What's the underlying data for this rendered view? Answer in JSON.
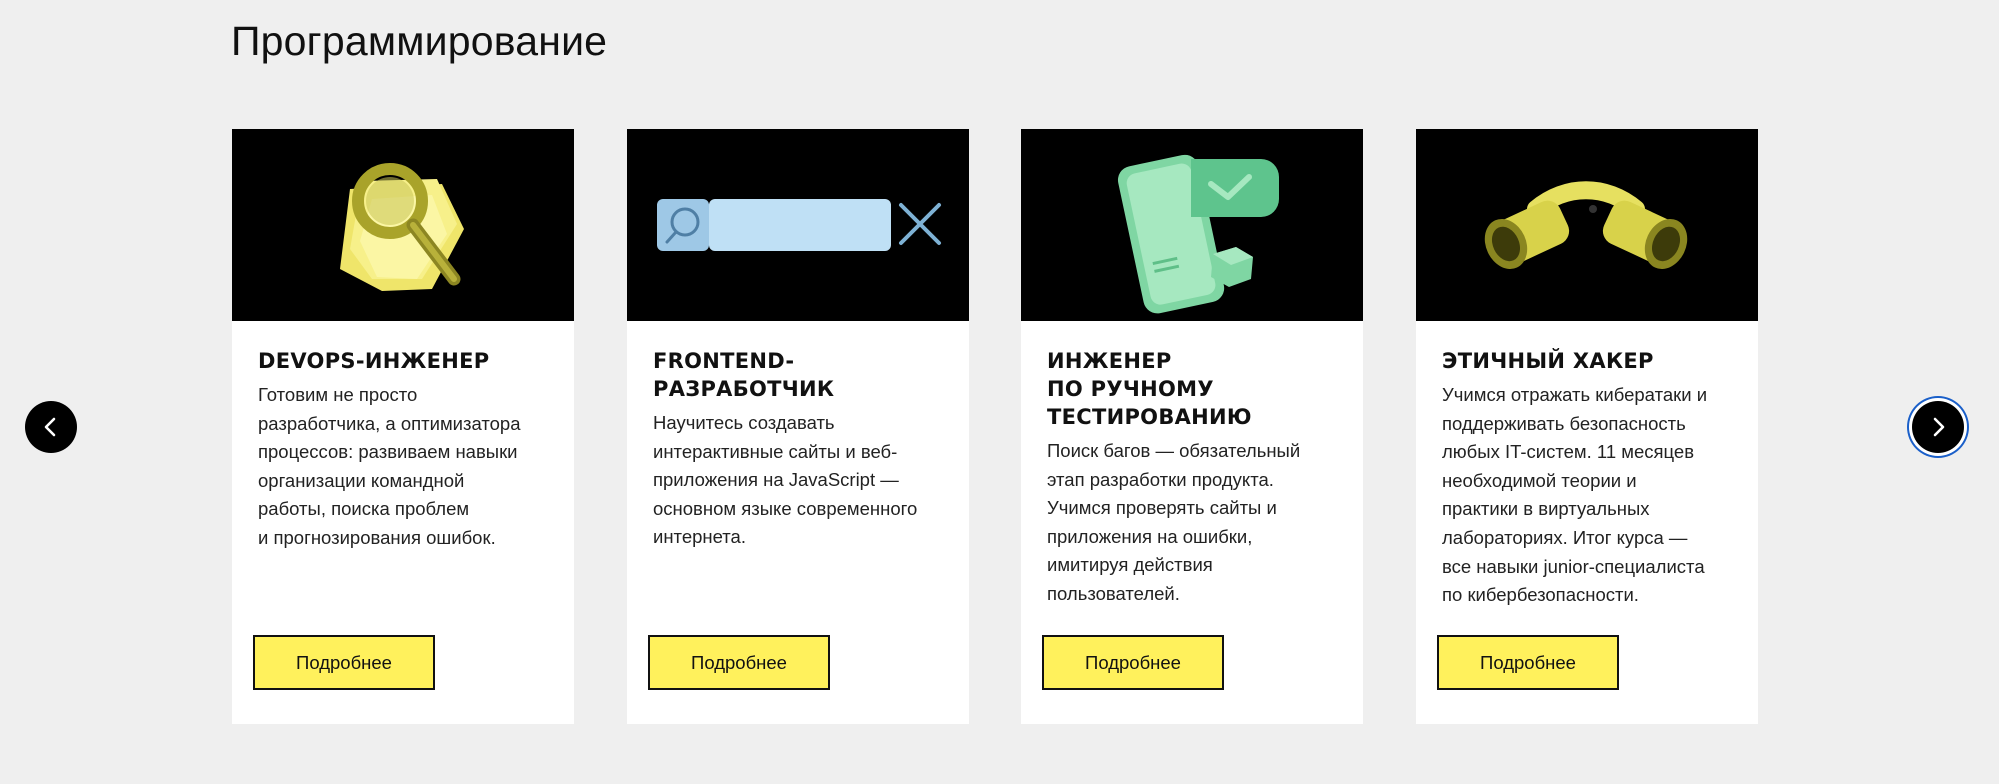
{
  "section": {
    "title": "Программирование"
  },
  "cards": [
    {
      "title": "DevOps-инженер",
      "description": "Готовим не просто\nразработчика, а оптимизатора\nпроцессов: развиваем навыки\nорганизации командной\nработы, поиска проблем\nи прогнозирования ошибок.",
      "button_label": "Подробнее",
      "icon": "magnifier-documents-icon"
    },
    {
      "title": "Frontend-\nразработчик",
      "description": "Научитесь создавать\nинтерактивные сайты и веб-\nприложения на JavaScript —\nосновном языке современного\nинтернета.",
      "button_label": "Подробнее",
      "icon": "search-bar-icon"
    },
    {
      "title": "Инженер\nпо ручному\nтестированию",
      "description": "Поиск багов — обязательный\nэтап разработки продукта.\nУчимся проверять сайты и\nприложения на ошибки,\nимитируя действия\nпользователей.",
      "button_label": "Подробнее",
      "icon": "phone-checkmark-icon"
    },
    {
      "title": "Этичный хакер",
      "description": "Учимся отражать кибератаки и\nподдерживать безопасность\nлюбых IT-систем. 11 месяцев\nнеобходимой теории и\nпрактики в виртуальных\nлабораториях. Итог курса —\nвсе навыки junior-специалиста\nпо кибербезопасности.",
      "button_label": "Подробнее",
      "icon": "binoculars-icon"
    }
  ],
  "carousel": {
    "prev_icon": "chevron-left-icon",
    "next_icon": "chevron-right-icon"
  },
  "colors": {
    "page_bg": "#efefef",
    "card_bg": "#ffffff",
    "media_bg": "#000000",
    "button_bg": "#fff15c",
    "focus_ring": "#1a5fc9"
  }
}
